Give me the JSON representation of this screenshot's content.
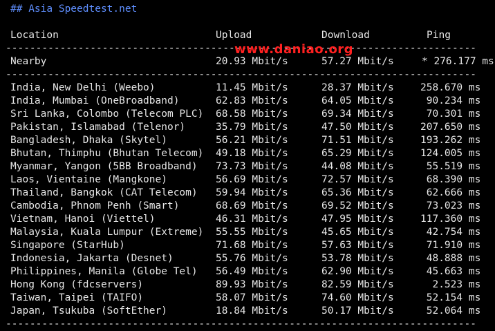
{
  "title": "## Asia Speedtest.net",
  "headers": {
    "location": "Location",
    "upload": "Upload",
    "download": "Download",
    "ping": "Ping"
  },
  "separator": "-------------------------------------------------------------------------------------------",
  "watermark": "www.daniao.org",
  "nearby": {
    "location": "Nearby",
    "upload": "20.93 Mbit/s",
    "download": "57.27 Mbit/s",
    "ping": "* 276.177 ms"
  },
  "rows": [
    {
      "location": "India, New Delhi (Weebo)",
      "upload": "11.45 Mbit/s",
      "download": "28.37 Mbit/s",
      "ping": "258.670 ms"
    },
    {
      "location": "India, Mumbai (OneBroadband)",
      "upload": "62.83 Mbit/s",
      "download": "64.05 Mbit/s",
      "ping": " 90.234 ms"
    },
    {
      "location": "Sri Lanka, Colombo (Telecom PLC)",
      "upload": "68.58 Mbit/s",
      "download": "69.34 Mbit/s",
      "ping": " 70.301 ms"
    },
    {
      "location": "Pakistan, Islamabad (Telenor)",
      "upload": "35.79 Mbit/s",
      "download": "47.50 Mbit/s",
      "ping": "207.650 ms"
    },
    {
      "location": "Bangladesh, Dhaka (Skytel)",
      "upload": "56.21 Mbit/s",
      "download": "71.51 Mbit/s",
      "ping": "193.262 ms"
    },
    {
      "location": "Bhutan, Thimphu (Bhutan Telecom)",
      "upload": "49.18 Mbit/s",
      "download": "65.29 Mbit/s",
      "ping": "124.005 ms"
    },
    {
      "location": "Myanmar, Yangon (5BB Broadband)",
      "upload": "73.73 Mbit/s",
      "download": "44.08 Mbit/s",
      "ping": " 55.519 ms"
    },
    {
      "location": "Laos, Vientaine (Mangkone)",
      "upload": "56.69 Mbit/s",
      "download": "72.57 Mbit/s",
      "ping": " 68.390 ms"
    },
    {
      "location": "Thailand, Bangkok (CAT Telecom)",
      "upload": "59.94 Mbit/s",
      "download": "65.36 Mbit/s",
      "ping": " 62.666 ms"
    },
    {
      "location": "Cambodia, Phnom Penh (Smart)",
      "upload": "68.69 Mbit/s",
      "download": "69.52 Mbit/s",
      "ping": " 73.023 ms"
    },
    {
      "location": "Vietnam, Hanoi (Viettel)",
      "upload": "46.31 Mbit/s",
      "download": "47.95 Mbit/s",
      "ping": "117.360 ms"
    },
    {
      "location": "Malaysia, Kuala Lumpur (Extreme)",
      "upload": "55.55 Mbit/s",
      "download": "45.65 Mbit/s",
      "ping": " 42.754 ms"
    },
    {
      "location": "Singapore (StarHub)",
      "upload": "71.68 Mbit/s",
      "download": "57.63 Mbit/s",
      "ping": " 71.910 ms"
    },
    {
      "location": "Indonesia, Jakarta (Desnet)",
      "upload": "55.76 Mbit/s",
      "download": "53.78 Mbit/s",
      "ping": " 48.888 ms"
    },
    {
      "location": "Philippines, Manila (Globe Tel)",
      "upload": "56.49 Mbit/s",
      "download": "62.90 Mbit/s",
      "ping": " 45.663 ms"
    },
    {
      "location": "Hong Kong (fdcservers)",
      "upload": "89.93 Mbit/s",
      "download": "82.59 Mbit/s",
      "ping": "  2.523 ms"
    },
    {
      "location": "Taiwan, Taipei (TAIFO)",
      "upload": "58.07 Mbit/s",
      "download": "74.60 Mbit/s",
      "ping": " 52.154 ms"
    },
    {
      "location": "Japan, Tsukuba (SoftEther)",
      "upload": "18.84 Mbit/s",
      "download": "50.17 Mbit/s",
      "ping": " 52.064 ms"
    }
  ],
  "colors": {
    "background": "#000000",
    "text": "#e6e6e6",
    "title": "#5f8fff",
    "watermark": "#ff2020"
  }
}
